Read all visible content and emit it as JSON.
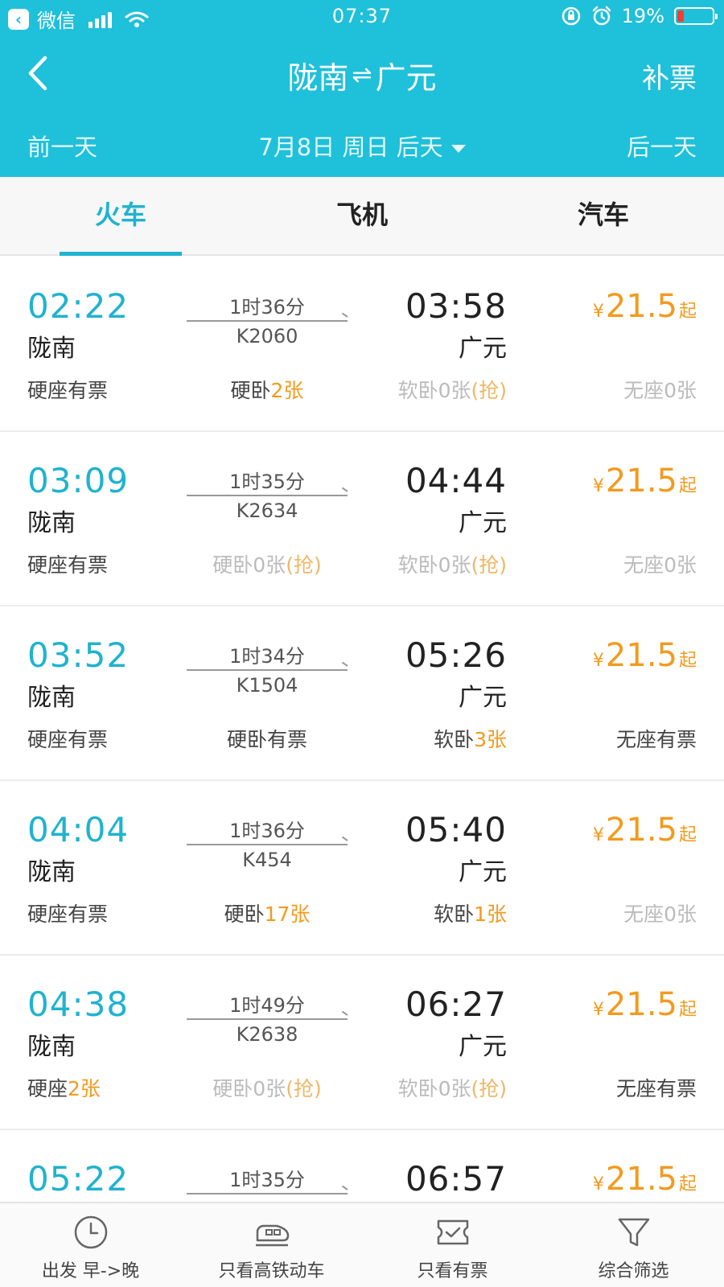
{
  "status_bar": {
    "app": "微信",
    "time": "07:37",
    "battery": "19%"
  },
  "nav": {
    "from": "陇南",
    "swap": "⇌",
    "to": "广元",
    "right_label": "补票"
  },
  "date_bar": {
    "prev": "前一天",
    "current": "7月8日 周日 后天",
    "next": "后一天"
  },
  "tabs": [
    {
      "label": "火车",
      "active": true
    },
    {
      "label": "飞机",
      "active": false
    },
    {
      "label": "汽车",
      "active": false
    }
  ],
  "price_unit": "¥",
  "price_suffix": "起",
  "trains": [
    {
      "dep_time": "02:22",
      "dep_station": "陇南",
      "duration": "1时36分",
      "train_no": "K2060",
      "arr_time": "03:58",
      "arr_station": "广元",
      "price": "21.5",
      "seats": [
        {
          "name": "硬座",
          "status": "有票",
          "available": true,
          "highlight": false
        },
        {
          "name": "硬卧",
          "status": "2张",
          "available": true,
          "highlight": true
        },
        {
          "name": "软卧",
          "status": "0张",
          "extra": "(抢)",
          "available": false
        },
        {
          "name": "无座",
          "status": "0张",
          "available": false
        }
      ]
    },
    {
      "dep_time": "03:09",
      "dep_station": "陇南",
      "duration": "1时35分",
      "train_no": "K2634",
      "arr_time": "04:44",
      "arr_station": "广元",
      "price": "21.5",
      "seats": [
        {
          "name": "硬座",
          "status": "有票",
          "available": true,
          "highlight": false
        },
        {
          "name": "硬卧",
          "status": "0张",
          "extra": "(抢)",
          "available": false
        },
        {
          "name": "软卧",
          "status": "0张",
          "extra": "(抢)",
          "available": false
        },
        {
          "name": "无座",
          "status": "0张",
          "available": false
        }
      ]
    },
    {
      "dep_time": "03:52",
      "dep_station": "陇南",
      "duration": "1时34分",
      "train_no": "K1504",
      "arr_time": "05:26",
      "arr_station": "广元",
      "price": "21.5",
      "seats": [
        {
          "name": "硬座",
          "status": "有票",
          "available": true,
          "highlight": false
        },
        {
          "name": "硬卧",
          "status": "有票",
          "available": true,
          "highlight": false
        },
        {
          "name": "软卧",
          "status": "3张",
          "available": true,
          "highlight": true
        },
        {
          "name": "无座",
          "status": "有票",
          "available": true,
          "highlight": false
        }
      ]
    },
    {
      "dep_time": "04:04",
      "dep_station": "陇南",
      "duration": "1时36分",
      "train_no": "K454",
      "arr_time": "05:40",
      "arr_station": "广元",
      "price": "21.5",
      "seats": [
        {
          "name": "硬座",
          "status": "有票",
          "available": true,
          "highlight": false
        },
        {
          "name": "硬卧",
          "status": "17张",
          "available": true,
          "highlight": true
        },
        {
          "name": "软卧",
          "status": "1张",
          "available": true,
          "highlight": true
        },
        {
          "name": "无座",
          "status": "0张",
          "available": false
        }
      ]
    },
    {
      "dep_time": "04:38",
      "dep_station": "陇南",
      "duration": "1时49分",
      "train_no": "K2638",
      "arr_time": "06:27",
      "arr_station": "广元",
      "price": "21.5",
      "seats": [
        {
          "name": "硬座",
          "status": "2张",
          "available": true,
          "highlight": true
        },
        {
          "name": "硬卧",
          "status": "0张",
          "extra": "(抢)",
          "available": false
        },
        {
          "name": "软卧",
          "status": "0张",
          "extra": "(抢)",
          "available": false
        },
        {
          "name": "无座",
          "status": "有票",
          "available": true,
          "highlight": false
        }
      ]
    },
    {
      "dep_time": "05:22",
      "dep_station": "",
      "duration": "1时35分",
      "train_no": "",
      "arr_time": "06:57",
      "arr_station": "",
      "price": "21.5",
      "seats": []
    }
  ],
  "bottom_bar": [
    {
      "label": "出发 早->晚",
      "icon": "clock-icon"
    },
    {
      "label": "只看高铁动车",
      "icon": "high-speed-train-icon"
    },
    {
      "label": "只看有票",
      "icon": "ticket-check-icon"
    },
    {
      "label": "综合筛选",
      "icon": "filter-icon"
    }
  ],
  "colors": {
    "header": "#1fc0d9",
    "accent": "#1fb3cf",
    "price": "#f39a1e",
    "unavailable": "#bbbbbb"
  }
}
